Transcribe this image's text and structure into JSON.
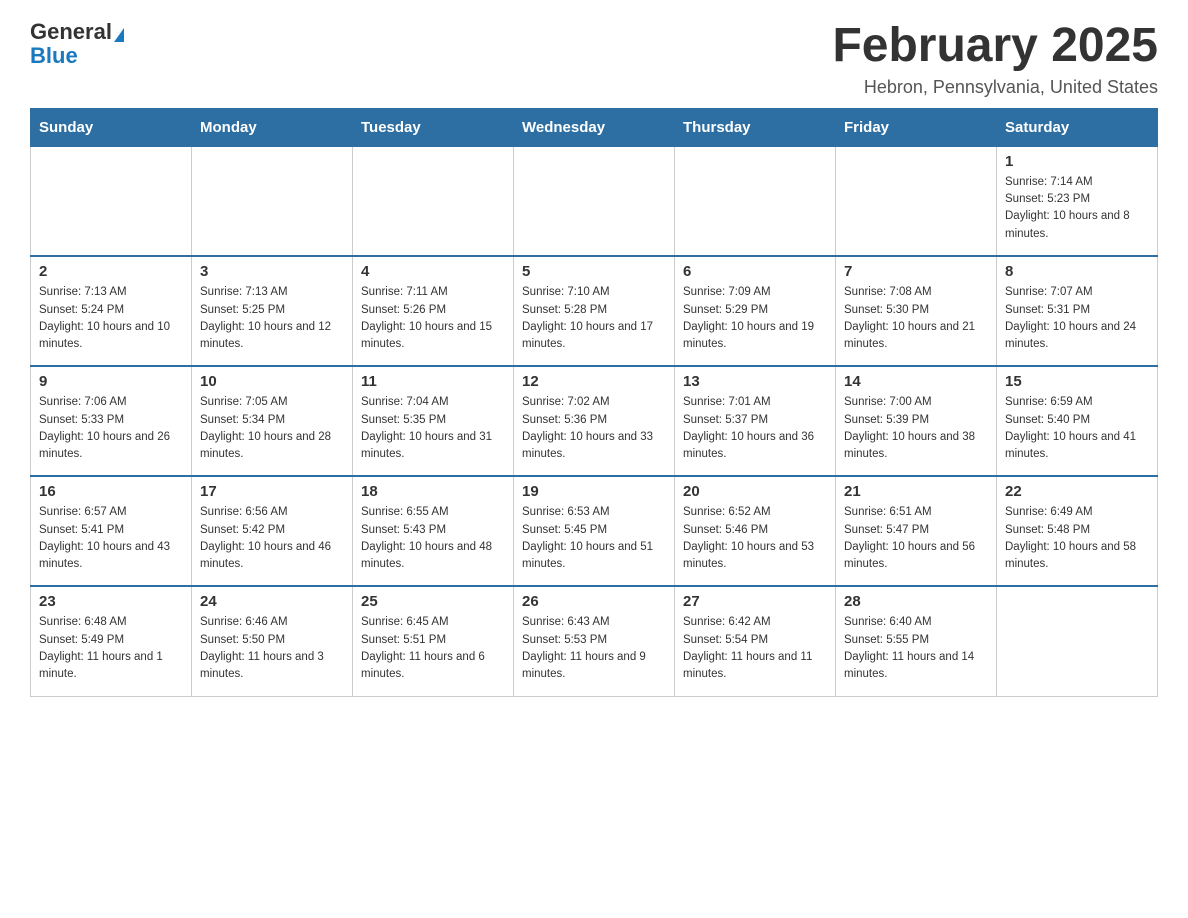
{
  "header": {
    "logo_general": "General",
    "logo_blue": "Blue",
    "main_title": "February 2025",
    "subtitle": "Hebron, Pennsylvania, United States"
  },
  "days_of_week": [
    "Sunday",
    "Monday",
    "Tuesday",
    "Wednesday",
    "Thursday",
    "Friday",
    "Saturday"
  ],
  "weeks": [
    [
      {
        "day": "",
        "info": ""
      },
      {
        "day": "",
        "info": ""
      },
      {
        "day": "",
        "info": ""
      },
      {
        "day": "",
        "info": ""
      },
      {
        "day": "",
        "info": ""
      },
      {
        "day": "",
        "info": ""
      },
      {
        "day": "1",
        "info": "Sunrise: 7:14 AM\nSunset: 5:23 PM\nDaylight: 10 hours and 8 minutes."
      }
    ],
    [
      {
        "day": "2",
        "info": "Sunrise: 7:13 AM\nSunset: 5:24 PM\nDaylight: 10 hours and 10 minutes."
      },
      {
        "day": "3",
        "info": "Sunrise: 7:13 AM\nSunset: 5:25 PM\nDaylight: 10 hours and 12 minutes."
      },
      {
        "day": "4",
        "info": "Sunrise: 7:11 AM\nSunset: 5:26 PM\nDaylight: 10 hours and 15 minutes."
      },
      {
        "day": "5",
        "info": "Sunrise: 7:10 AM\nSunset: 5:28 PM\nDaylight: 10 hours and 17 minutes."
      },
      {
        "day": "6",
        "info": "Sunrise: 7:09 AM\nSunset: 5:29 PM\nDaylight: 10 hours and 19 minutes."
      },
      {
        "day": "7",
        "info": "Sunrise: 7:08 AM\nSunset: 5:30 PM\nDaylight: 10 hours and 21 minutes."
      },
      {
        "day": "8",
        "info": "Sunrise: 7:07 AM\nSunset: 5:31 PM\nDaylight: 10 hours and 24 minutes."
      }
    ],
    [
      {
        "day": "9",
        "info": "Sunrise: 7:06 AM\nSunset: 5:33 PM\nDaylight: 10 hours and 26 minutes."
      },
      {
        "day": "10",
        "info": "Sunrise: 7:05 AM\nSunset: 5:34 PM\nDaylight: 10 hours and 28 minutes."
      },
      {
        "day": "11",
        "info": "Sunrise: 7:04 AM\nSunset: 5:35 PM\nDaylight: 10 hours and 31 minutes."
      },
      {
        "day": "12",
        "info": "Sunrise: 7:02 AM\nSunset: 5:36 PM\nDaylight: 10 hours and 33 minutes."
      },
      {
        "day": "13",
        "info": "Sunrise: 7:01 AM\nSunset: 5:37 PM\nDaylight: 10 hours and 36 minutes."
      },
      {
        "day": "14",
        "info": "Sunrise: 7:00 AM\nSunset: 5:39 PM\nDaylight: 10 hours and 38 minutes."
      },
      {
        "day": "15",
        "info": "Sunrise: 6:59 AM\nSunset: 5:40 PM\nDaylight: 10 hours and 41 minutes."
      }
    ],
    [
      {
        "day": "16",
        "info": "Sunrise: 6:57 AM\nSunset: 5:41 PM\nDaylight: 10 hours and 43 minutes."
      },
      {
        "day": "17",
        "info": "Sunrise: 6:56 AM\nSunset: 5:42 PM\nDaylight: 10 hours and 46 minutes."
      },
      {
        "day": "18",
        "info": "Sunrise: 6:55 AM\nSunset: 5:43 PM\nDaylight: 10 hours and 48 minutes."
      },
      {
        "day": "19",
        "info": "Sunrise: 6:53 AM\nSunset: 5:45 PM\nDaylight: 10 hours and 51 minutes."
      },
      {
        "day": "20",
        "info": "Sunrise: 6:52 AM\nSunset: 5:46 PM\nDaylight: 10 hours and 53 minutes."
      },
      {
        "day": "21",
        "info": "Sunrise: 6:51 AM\nSunset: 5:47 PM\nDaylight: 10 hours and 56 minutes."
      },
      {
        "day": "22",
        "info": "Sunrise: 6:49 AM\nSunset: 5:48 PM\nDaylight: 10 hours and 58 minutes."
      }
    ],
    [
      {
        "day": "23",
        "info": "Sunrise: 6:48 AM\nSunset: 5:49 PM\nDaylight: 11 hours and 1 minute."
      },
      {
        "day": "24",
        "info": "Sunrise: 6:46 AM\nSunset: 5:50 PM\nDaylight: 11 hours and 3 minutes."
      },
      {
        "day": "25",
        "info": "Sunrise: 6:45 AM\nSunset: 5:51 PM\nDaylight: 11 hours and 6 minutes."
      },
      {
        "day": "26",
        "info": "Sunrise: 6:43 AM\nSunset: 5:53 PM\nDaylight: 11 hours and 9 minutes."
      },
      {
        "day": "27",
        "info": "Sunrise: 6:42 AM\nSunset: 5:54 PM\nDaylight: 11 hours and 11 minutes."
      },
      {
        "day": "28",
        "info": "Sunrise: 6:40 AM\nSunset: 5:55 PM\nDaylight: 11 hours and 14 minutes."
      },
      {
        "day": "",
        "info": ""
      }
    ]
  ]
}
